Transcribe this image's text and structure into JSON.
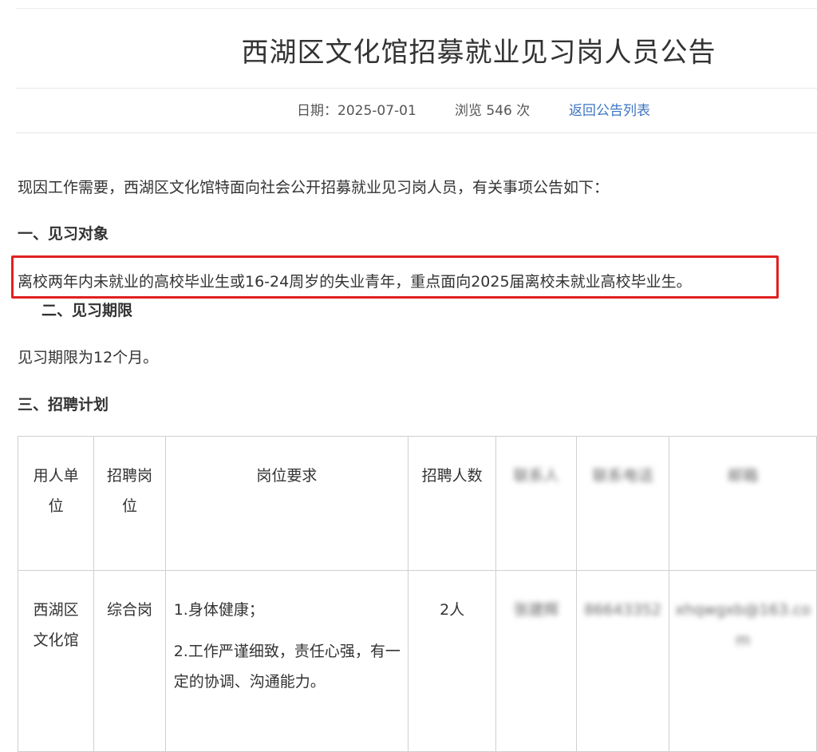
{
  "article": {
    "title": "西湖区文化馆招募就业见习岗人员公告",
    "meta": {
      "date": "日期：2025-07-01",
      "views": "浏览 546 次",
      "back_link": "返回公告列表"
    },
    "intro": "现因工作需要，西湖区文化馆特面向社会公开招募就业见习岗人员，有关事项公告如下：",
    "sections": [
      {
        "heading": "一、见习对象",
        "body": "离校两年内未就业的高校毕业生或16-24周岁的失业青年，重点面向2025届离校未就业高校毕业生。"
      },
      {
        "heading": "二、见习期限",
        "body": "见习期限为12个月。"
      },
      {
        "heading": "三、招聘计划"
      }
    ],
    "highlight_color": "#e02020"
  },
  "table": {
    "headers": [
      "用人单位",
      "招聘岗位",
      "岗位要求",
      "招聘人数",
      "联系人",
      "联系电话",
      "邮箱"
    ],
    "row": {
      "unit": "西湖区文化馆",
      "position": "综合岗",
      "requirements": [
        "1.身体健康；",
        "2.工作严谨细致，责任心强，有一定的协调、沟通能力。"
      ],
      "count": "2人",
      "contact": "张建辉",
      "phone": "86643352",
      "email": "xhqwgxb@163.com"
    }
  }
}
